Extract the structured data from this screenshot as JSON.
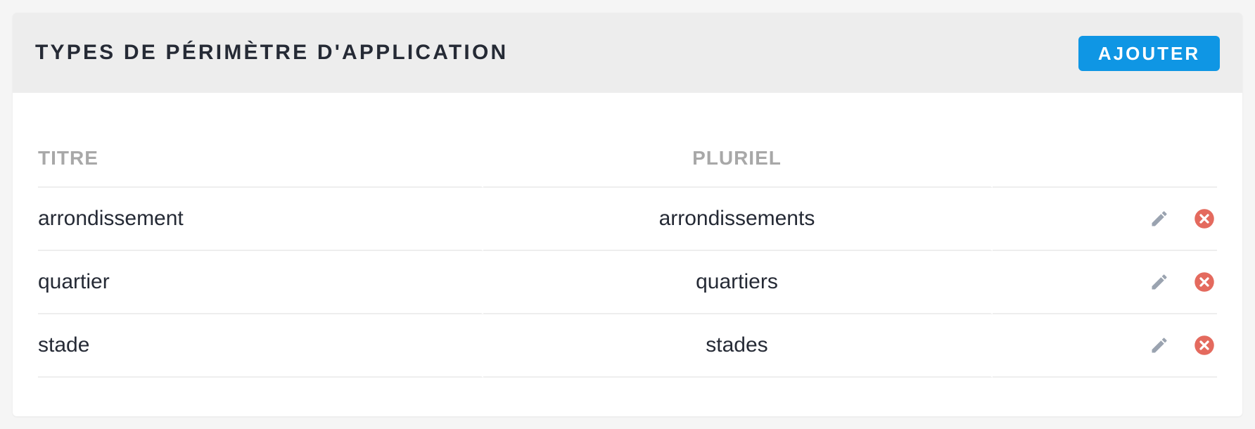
{
  "header": {
    "title": "TYPES DE PÉRIMÈTRE D'APPLICATION",
    "add_label": "AJOUTER"
  },
  "table": {
    "columns": {
      "title": "TITRE",
      "plural": "PLURIEL"
    },
    "rows": [
      {
        "title": "arrondissement",
        "plural": "arrondissements"
      },
      {
        "title": "quartier",
        "plural": "quartiers"
      },
      {
        "title": "stade",
        "plural": "stades"
      }
    ]
  },
  "icons": {
    "edit": "pencil-icon",
    "delete": "close-circle-icon"
  },
  "colors": {
    "accent": "#0f96e4",
    "header_bg": "#ededed",
    "delete": "#e46a5e",
    "edit": "#9aa3b0"
  }
}
